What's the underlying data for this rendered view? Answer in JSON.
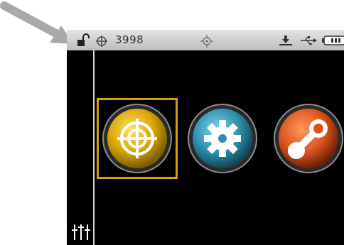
{
  "status_bar": {
    "count": "3998",
    "icons": [
      "unlocked-padlock-icon",
      "crosshair-icon",
      "target-icon",
      "download-icon",
      "usb-icon",
      "battery-icon"
    ]
  },
  "apps": [
    {
      "name": "measure",
      "icon": "target-icon",
      "color": "#d8a400",
      "selected": true
    },
    {
      "name": "settings",
      "icon": "gear-icon",
      "color": "#2d8fae",
      "selected": false
    },
    {
      "name": "connect",
      "icon": "link-icon",
      "color": "#d9531f",
      "selected": false
    }
  ],
  "sidebar": {
    "icon": "sliders-icon"
  },
  "colors": {
    "selection": "#d4a017",
    "status_bar": "#cfcfcf",
    "screen": "#000000"
  }
}
